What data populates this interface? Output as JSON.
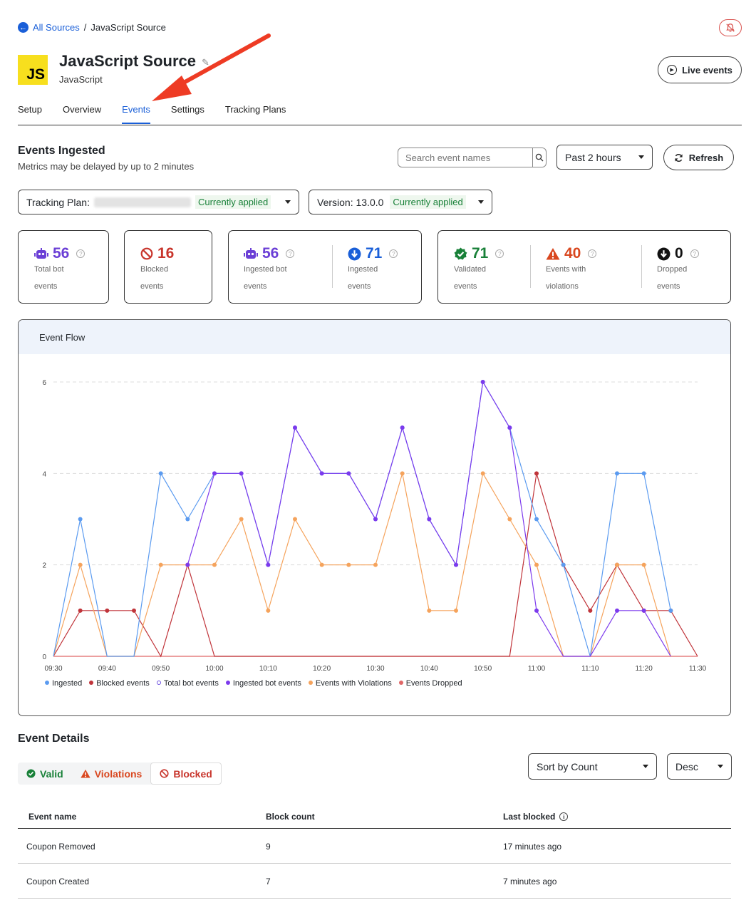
{
  "breadcrumb": {
    "back_label": "All Sources",
    "separator": "/",
    "current": "JavaScript Source"
  },
  "source": {
    "logo_text": "JS",
    "name": "JavaScript Source",
    "type": "JavaScript"
  },
  "header": {
    "live_events_label": "Live events"
  },
  "tabs": [
    {
      "label": "Setup",
      "active": false
    },
    {
      "label": "Overview",
      "active": false
    },
    {
      "label": "Events",
      "active": true
    },
    {
      "label": "Settings",
      "active": false
    },
    {
      "label": "Tracking Plans",
      "active": false
    }
  ],
  "events_ingested": {
    "title": "Events Ingested",
    "subtitle": "Metrics may be delayed by up to 2 minutes",
    "search_placeholder": "Search event names",
    "time_range": "Past 2 hours",
    "refresh_label": "Refresh",
    "tracking_plan_label": "Tracking Plan:",
    "tracking_plan_status": "Currently applied",
    "version_label": "Version: 13.0.0",
    "version_status": "Currently applied"
  },
  "metrics": {
    "total_bot": {
      "value": "56",
      "label_1": "Total bot",
      "label_2": "events",
      "color": "#6b3fd6"
    },
    "blocked": {
      "value": "16",
      "label_1": "Blocked",
      "label_2": "events",
      "color": "#c8352c"
    },
    "ingested_bot": {
      "value": "56",
      "label_1": "Ingested bot",
      "label_2": "events",
      "color": "#6b3fd6"
    },
    "ingested": {
      "value": "71",
      "label_1": "Ingested",
      "label_2": "events",
      "color": "#1a5fd8"
    },
    "validated": {
      "value": "71",
      "label_1": "Validated",
      "label_2": "events",
      "color": "#188038"
    },
    "violations": {
      "value": "40",
      "label_1": "Events with",
      "label_2": "violations",
      "color": "#d9471f"
    },
    "dropped": {
      "value": "0",
      "label_1": "Dropped",
      "label_2": "events",
      "color": "#111111"
    }
  },
  "chart_panel": {
    "title": "Event Flow"
  },
  "chart_data": {
    "type": "line",
    "x": [
      "09:30",
      "09:35",
      "09:40",
      "09:45",
      "09:50",
      "09:55",
      "10:00",
      "10:05",
      "10:10",
      "10:15",
      "10:20",
      "10:25",
      "10:30",
      "10:35",
      "10:40",
      "10:45",
      "10:50",
      "10:55",
      "11:00",
      "11:05",
      "11:10",
      "11:15",
      "11:20",
      "11:25",
      "11:30"
    ],
    "x_tick_labels": [
      "09:30",
      "09:40",
      "09:50",
      "10:00",
      "10:10",
      "10:20",
      "10:30",
      "10:40",
      "10:50",
      "11:00",
      "11:10",
      "11:20",
      "11:30"
    ],
    "y_ticks": [
      "0",
      "2",
      "4",
      "6"
    ],
    "ylim": [
      0,
      6
    ],
    "grid": true,
    "legend_position": "bottom-left",
    "series": [
      {
        "name": "Ingested",
        "color": "#5b9bf0",
        "values": [
          0,
          3,
          0,
          0,
          4,
          3,
          4,
          4,
          2,
          5,
          4,
          4,
          3,
          5,
          3,
          2,
          6,
          5,
          3,
          2,
          0,
          4,
          4,
          1,
          null
        ]
      },
      {
        "name": "Blocked events",
        "color": "#c0343a",
        "values": [
          0,
          1,
          1,
          1,
          0,
          2,
          0,
          0,
          0,
          0,
          0,
          0,
          0,
          0,
          0,
          0,
          0,
          0,
          4,
          2,
          1,
          2,
          1,
          1,
          0
        ]
      },
      {
        "name": "Total bot events",
        "color": "#6b4fe0",
        "hollow": true,
        "values": []
      },
      {
        "name": "Ingested bot events",
        "color": "#7c3aed",
        "values": [
          null,
          null,
          null,
          null,
          null,
          2,
          4,
          4,
          2,
          5,
          4,
          4,
          3,
          5,
          3,
          2,
          6,
          5,
          1,
          0,
          0,
          1,
          1,
          0,
          null
        ]
      },
      {
        "name": "Events with Violations",
        "color": "#f5a35c",
        "values": [
          0,
          2,
          0,
          0,
          2,
          2,
          2,
          3,
          1,
          3,
          2,
          2,
          2,
          4,
          1,
          1,
          4,
          3,
          2,
          0,
          0,
          2,
          2,
          0,
          null
        ]
      },
      {
        "name": "Events Dropped",
        "color": "#e06666",
        "values": [
          0,
          0,
          0,
          0,
          0,
          0,
          0,
          0,
          0,
          0,
          0,
          0,
          0,
          0,
          0,
          0,
          0,
          0,
          0,
          0,
          0,
          0,
          0,
          0,
          0
        ]
      }
    ]
  },
  "event_details": {
    "title": "Event Details",
    "filters": [
      {
        "label": "Valid",
        "color": "#188038"
      },
      {
        "label": "Violations",
        "color": "#d9471f"
      },
      {
        "label": "Blocked",
        "color": "#c8352c"
      }
    ],
    "sort_label": "Sort by Count",
    "order_label": "Desc",
    "columns": [
      "Event name",
      "Block count",
      "Last blocked"
    ],
    "rows": [
      {
        "name": "Coupon Removed",
        "count": "9",
        "last": "17 minutes ago"
      },
      {
        "name": "Coupon Created",
        "count": "7",
        "last": "7 minutes ago"
      }
    ]
  }
}
